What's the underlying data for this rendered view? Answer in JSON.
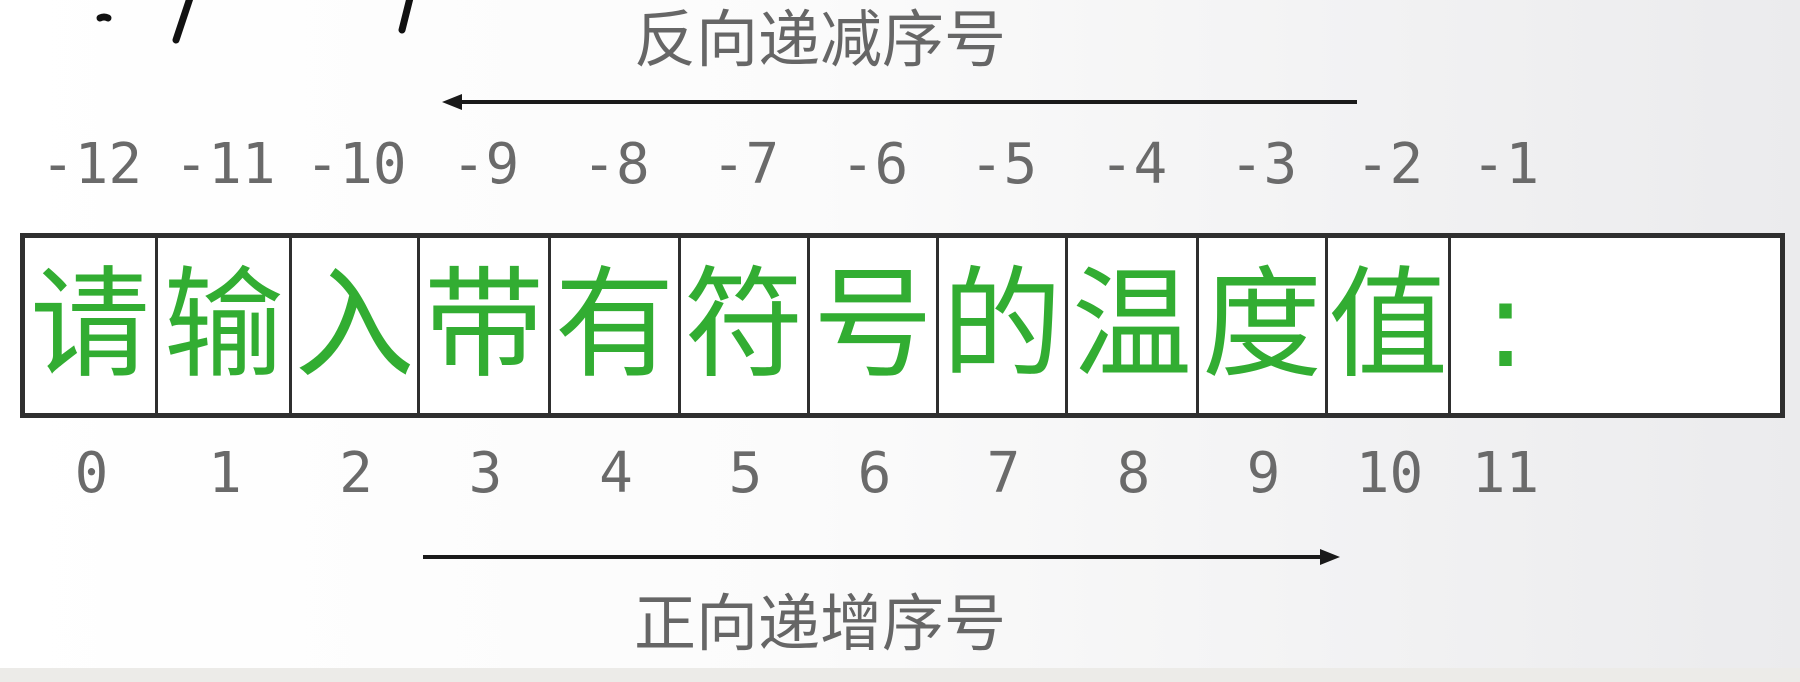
{
  "diagram": {
    "top_label": "反向递减序号",
    "bottom_label": "正向递增序号",
    "characters": [
      "请",
      "输",
      "入",
      "带",
      "有",
      "符",
      "号",
      "的",
      "温",
      "度",
      "值",
      ":"
    ],
    "negative_indices": [
      "-12",
      "-11",
      "-10",
      "-9",
      "-8",
      "-7",
      "-6",
      "-5",
      "-4",
      "-3",
      "-2",
      "-1"
    ],
    "positive_indices": [
      "0",
      "1",
      "2",
      "3",
      "4",
      "5",
      "6",
      "7",
      "8",
      "9",
      "10",
      "11"
    ]
  },
  "colors": {
    "character": "#32ad32",
    "index_text": "#6a6a6a",
    "label_text": "#666666",
    "border": "#2f2f2f",
    "arrow": "#1a1a1a"
  },
  "icons": [
    "handwritten-scribble-icon",
    "left-arrow-icon",
    "right-arrow-icon"
  ]
}
